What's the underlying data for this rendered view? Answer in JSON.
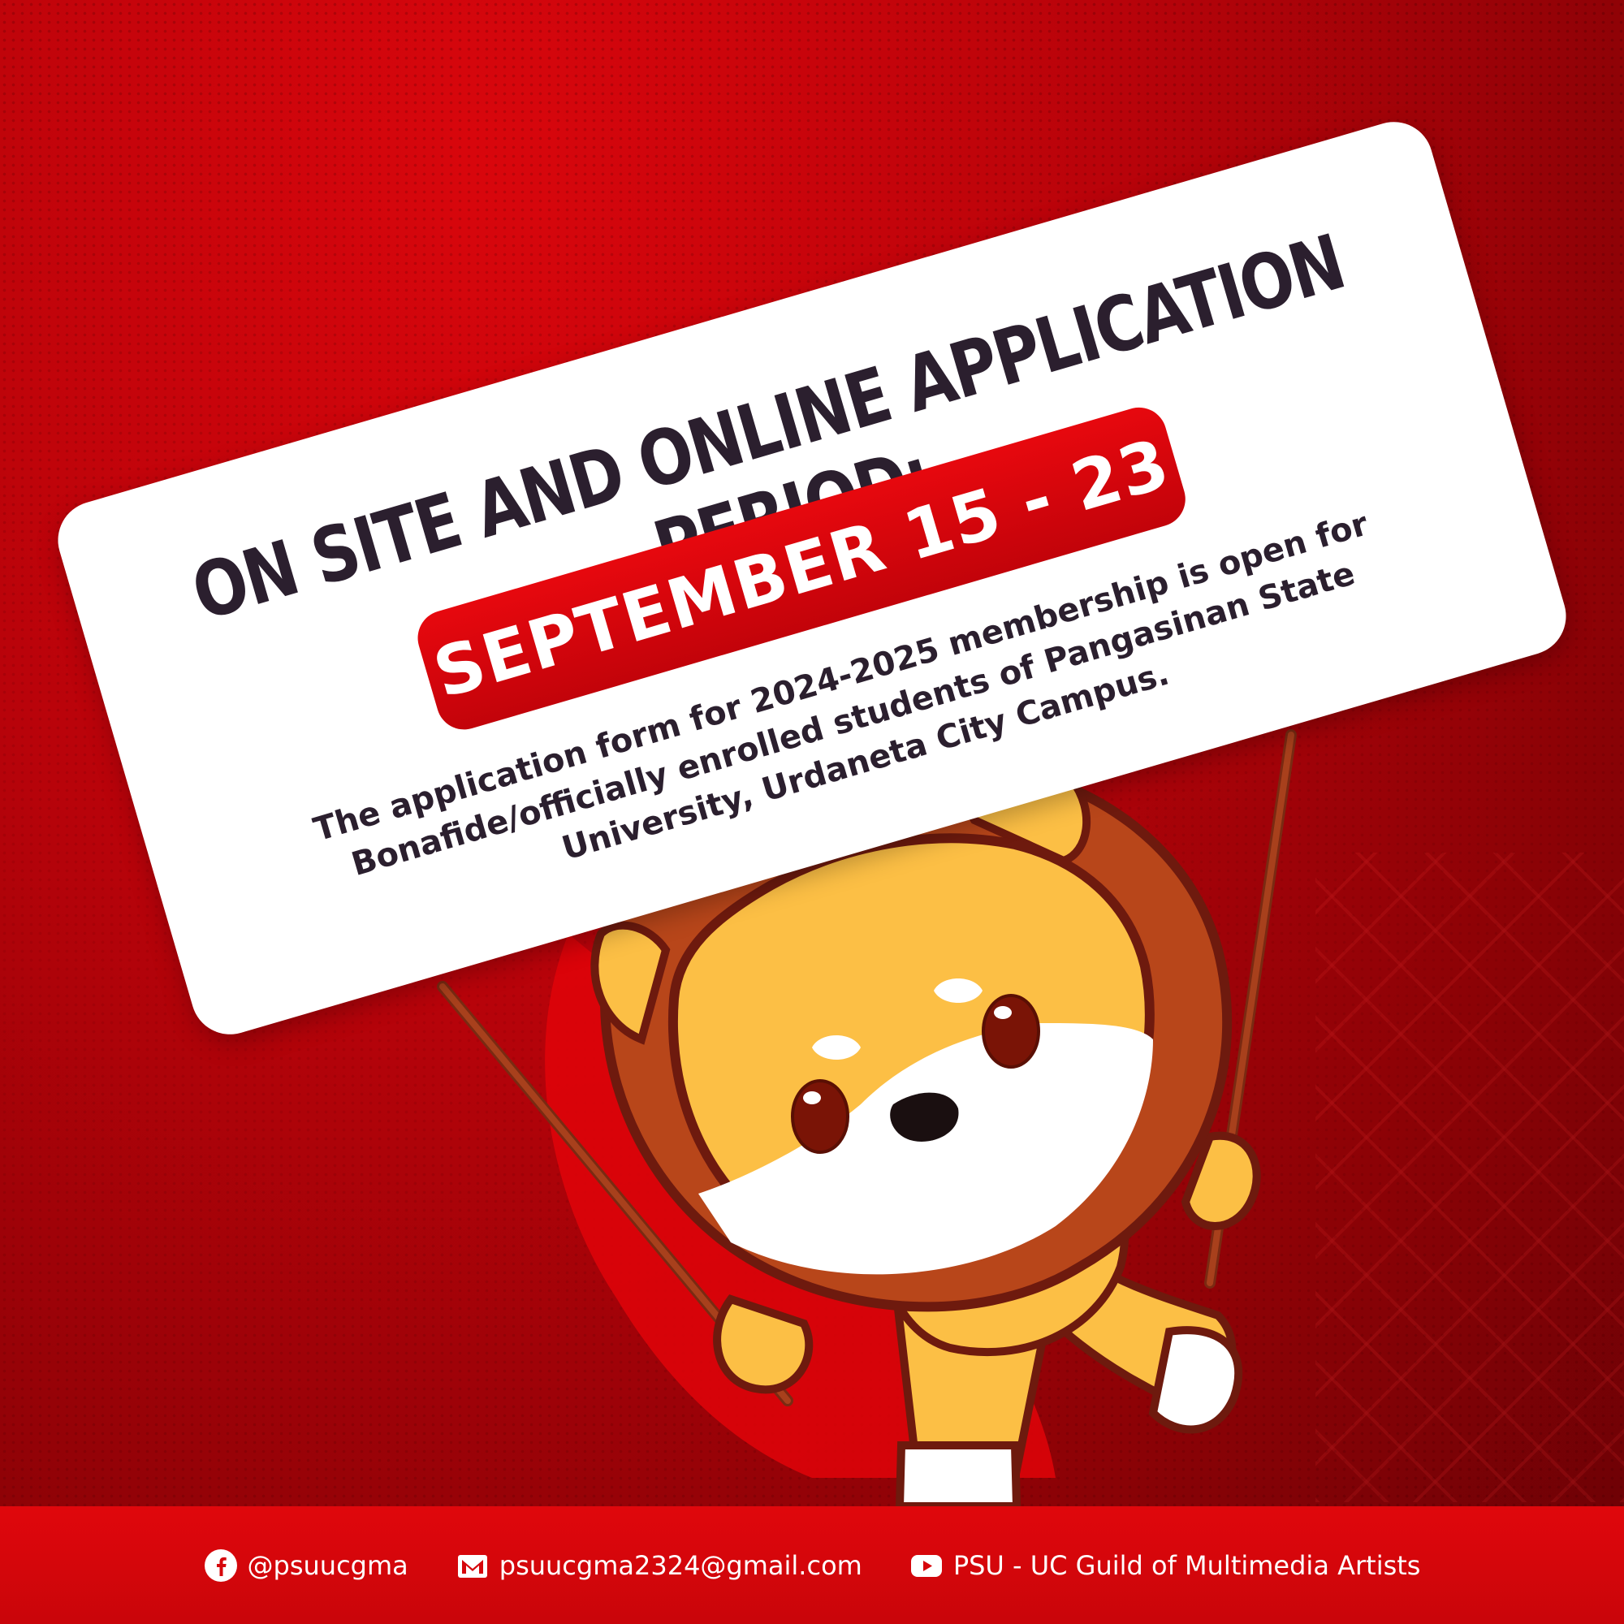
{
  "sign": {
    "title": "ON SITE AND ONLINE APPLICATION PERIOD:",
    "date": "SEPTEMBER 15 - 23",
    "body": "The application form for 2024-2025 membership is open for Bonafide/officially enrolled students of Pangasinan State University, Urdaneta City Campus."
  },
  "footer": {
    "facebook": "@psuucgma",
    "email": "psuucgma2324@gmail.com",
    "youtube": "PSU - UC Guild of Multimedia Artists"
  },
  "icons": {
    "facebook": "facebook-icon",
    "email": "mail-icon",
    "youtube": "youtube-icon"
  },
  "colors": {
    "background": "#c0040a",
    "accent_red": "#e7080e",
    "text_dark": "#2b1f2e",
    "footer": "#d6060b",
    "mascot_fur": "#fcbf45",
    "mascot_mane": "#b8461a"
  }
}
